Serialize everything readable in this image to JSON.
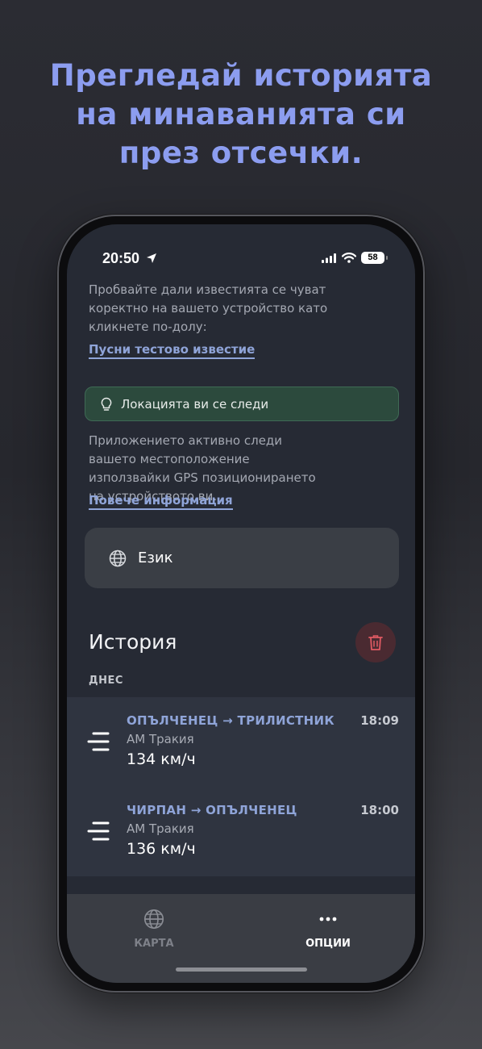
{
  "headline": {
    "line1": "Прегледай историята",
    "line2": "на минаванията си",
    "line3": "през отсечки."
  },
  "status_bar": {
    "time": "20:50",
    "battery": "58",
    "icons": [
      "location-arrow-icon",
      "signal-icon",
      "wifi-icon",
      "battery-icon"
    ]
  },
  "notifications": {
    "description": "Пробвайте дали известията се чуват коректно на вашето устройство като кликнете по-долу:",
    "test_link": "Пусни тестово известие"
  },
  "tracking": {
    "alert_text": "Локацията ви се следи",
    "alert_icon": "lightbulb-icon",
    "description": "Приложението активно следи вашето местоположение използвайки GPS позиционирането на устройството ви.",
    "more_link": "Повече информация"
  },
  "language": {
    "label": "Език",
    "icon": "globe-icon"
  },
  "history": {
    "title": "История",
    "section": "ДНЕС",
    "items": [
      {
        "route": "ОПЪЛЧЕНЕЦ → ТРИЛИСТНИК",
        "road": "АМ Тракия",
        "speed": "134 км/ч",
        "time": "18:09"
      },
      {
        "route": "ЧИРПАН → ОПЪЛЧЕНЕЦ",
        "road": "АМ Тракия",
        "speed": "136 км/ч",
        "time": "18:00"
      }
    ]
  },
  "tabbar": {
    "map_label": "КАРТА",
    "options_label": "ОПЦИИ"
  },
  "colors": {
    "accent": "#8c9df0",
    "link": "#8fa4d8",
    "alert_bg": "#2c4a3d",
    "danger": "#e05a63",
    "screen_bg": "#262a34"
  }
}
